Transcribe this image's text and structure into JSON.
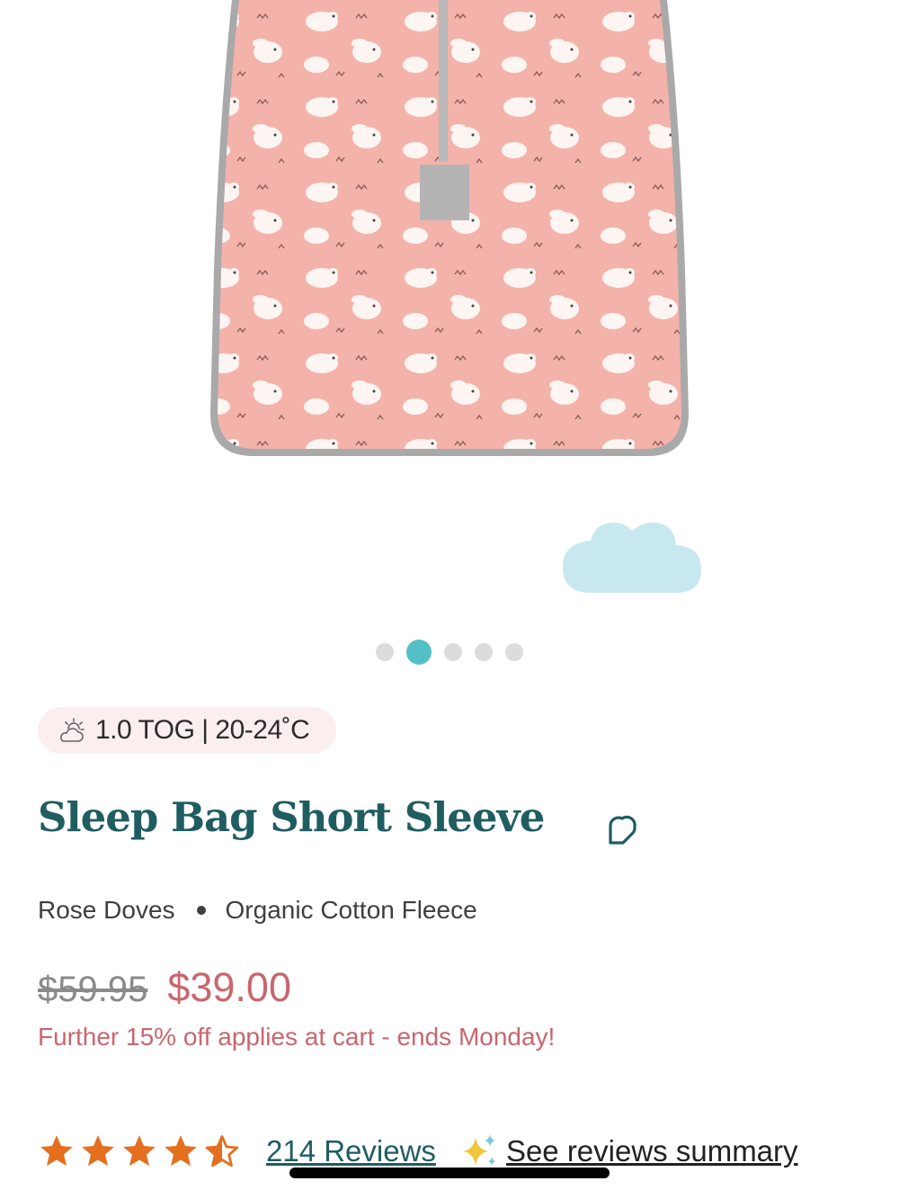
{
  "product_image": {
    "alt": "Sleep Bag Short Sleeve - Rose Doves"
  },
  "carousel": {
    "dots": 5,
    "active_index": 1
  },
  "colors": {
    "accent": "#55bfc8",
    "brand": "#1f5d61",
    "sale": "#c8676e",
    "star": "#e46f1f",
    "pill": "#fbeeee"
  },
  "tog": {
    "icon": "cloud-sun-icon",
    "label": "1.0 TOG | 20-24˚C"
  },
  "product": {
    "title": "Sleep Bag Short Sleeve",
    "print": "Rose Doves",
    "fabric": "Organic Cotton Fleece",
    "wishlist_icon": "heart-outline-icon"
  },
  "pricing": {
    "original": "$59.95",
    "sale": "$39.00",
    "promo": "Further 15% off applies at cart - ends Monday!"
  },
  "reviews": {
    "rating": 4.5,
    "max": 5,
    "count_label": "214 Reviews",
    "summary_icon": "sparkle-icon",
    "summary_label": "See reviews summary"
  }
}
